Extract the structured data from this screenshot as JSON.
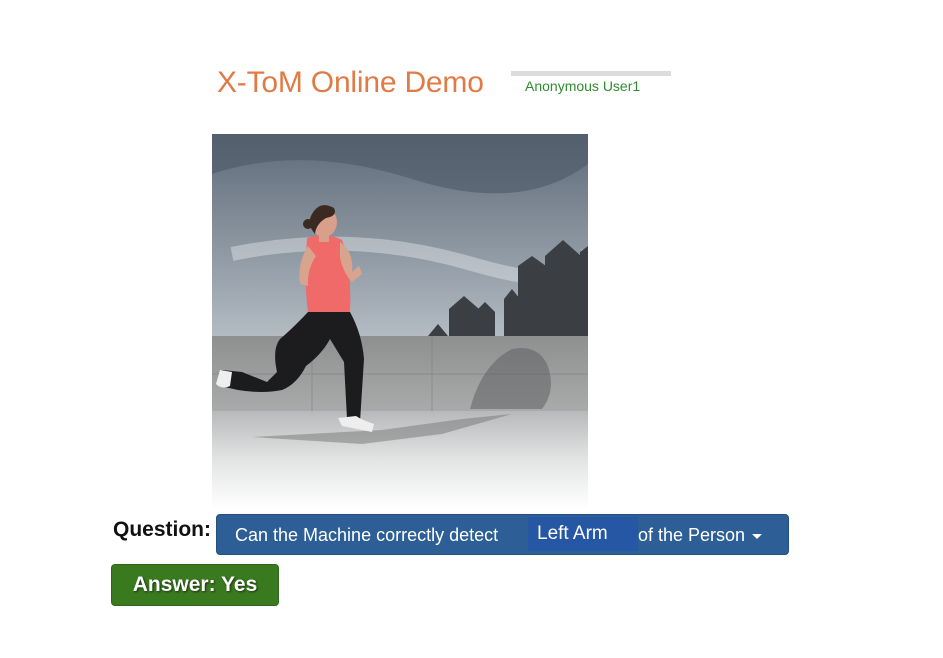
{
  "header": {
    "title": "X-ToM Online Demo",
    "user": "Anonymous User1"
  },
  "image": {
    "subject": "woman-running-photo"
  },
  "question": {
    "label": "Question:",
    "prefix": "Can the Machine correctly detect",
    "part": "Left Arm",
    "suffix": "of the Person"
  },
  "answer": {
    "label": "Answer: Yes"
  },
  "colors": {
    "title": "#e07b45",
    "user": "#2e8b2e",
    "dropdown": "#2d5f96",
    "answer": "#3a7a1f"
  }
}
